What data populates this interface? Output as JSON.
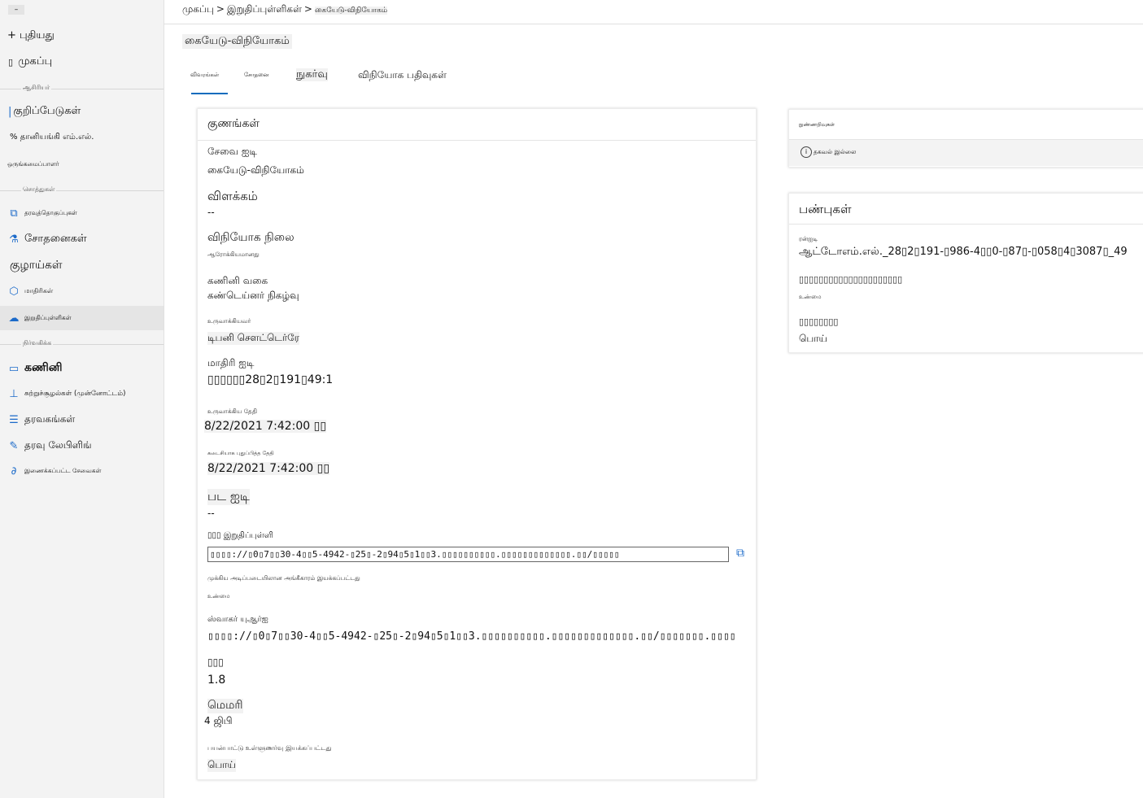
{
  "sidebar": {
    "collapse_label": "–",
    "new_label": "+ புதியது",
    "home_label": "முகப்பு",
    "sections": {
      "author": "ஆசிரியர்",
      "assets": "சொத்துகள்",
      "manage": "நிர்வகிக்க"
    },
    "items": [
      {
        "label": "குறிப்பேடுகள்",
        "icon": "notebook-icon"
      },
      {
        "label": "% தானியங்கி எம்.எல்.",
        "icon": "automl-icon"
      },
      {
        "label": "ஒருங்கமைப்பாளர்",
        "icon": "designer-icon"
      },
      {
        "label": "தரவுத்தொகுப்புகள்",
        "icon": "datasets-icon"
      },
      {
        "label": "சோதனைகள்",
        "icon": "flask-icon"
      },
      {
        "label": "குழாய்கள்",
        "icon": "pipeline-icon"
      },
      {
        "label": "மாதிரிகள்",
        "icon": "cube-icon"
      },
      {
        "label": "இறுதிப்புள்ளிகள்",
        "icon": "cloud-icon"
      },
      {
        "label": "கணினி",
        "icon": "monitor-icon"
      },
      {
        "label": "சுற்றுச்சூழல்கள் (முன்னோட்டம்)",
        "icon": "environment-icon"
      },
      {
        "label": "தரவகங்கள்",
        "icon": "database-icon"
      },
      {
        "label": "தரவு லேபிளிங்",
        "icon": "edit-icon"
      },
      {
        "label": "இணைக்கப்பட்ட சேவைகள்",
        "icon": "link-icon"
      }
    ]
  },
  "breadcrumb": {
    "home": "முகப்பு",
    "endpoints": "இறுதிப்புள்ளிகள்",
    "current": "கையேடு-விநியோகம்",
    "sep": ">"
  },
  "page_title": "கையேடு-விநியோகம்",
  "tabs": [
    {
      "label": "விவரங்கள்"
    },
    {
      "label": "சோதனை"
    },
    {
      "label": "நுகர்வு"
    },
    {
      "label": "விநியோக பதிவுகள்"
    }
  ],
  "attributes": {
    "title": "குணங்கள்",
    "service_id_label": "சேவை ஐடி",
    "service_id": "கையேடு-விநியோகம்",
    "description_label": "விளக்கம்",
    "description": "--",
    "deploy_state_label": "விநியோக நிலை",
    "deploy_state": "ஆரோக்கியமானது",
    "compute_type_label": "கணினி வகை",
    "compute_type": "கண்டெய்னர் நிகழ்வு",
    "created_by_label": "உருவாக்கியவர்",
    "created_by": "டிபனி சௌட்டெர்ரே",
    "model_id_label": "மாதிரி ஐடி",
    "model_id": "▯▯▯▯▯▯28▯2▯191▯49:1",
    "created_on_label": "உருவாக்கிய தேதி",
    "created_on": "8/22/2021 7:42:00 ▯▯",
    "updated_on_label": "கடைசியாக புதுப்பித்த தேதி",
    "updated_on": "8/22/2021 7:42:00 ▯▯",
    "image_id_label": "பட ஐடி",
    "image_id": "--",
    "rest_label": "▯▯▯ இறுதிப்புள்ளி",
    "rest_url": "▯▯▯▯://▯0▯7▯▯30-4▯▯5-4942-▯25▯-2▯94▯5▯1▯▯3.▯▯▯▯▯▯▯▯▯▯.▯▯▯▯▯▯▯▯▯▯▯▯▯.▯▯/▯▯▯▯▯",
    "key_auth_label": "முக்கிய அடிப்படையிலான அங்கீகாரம் இயக்கப்பட்டது",
    "key_auth": "உண்மை",
    "swagger_label": "ஸ்வாகர் யுஆர்ஐ",
    "swagger_url": "▯▯▯▯://▯0▯7▯▯30-4▯▯5-4942-▯25▯-2▯94▯5▯1▯▯3.▯▯▯▯▯▯▯▯▯▯.▯▯▯▯▯▯▯▯▯▯▯▯▯.▯▯/▯▯▯▯▯▯▯.▯▯▯▯",
    "cpu_label": "▯▯▯",
    "cpu": "1.8",
    "memory_label": "மெமரி",
    "memory": "4 ஜிபி",
    "appinsights_label": "பயன்பாட்டு உள்ளுணர்வு இயக்கப்பட்டது",
    "appinsights": "பொய்"
  },
  "insights_card": {
    "title": "நுண்ணறிவுகள்",
    "info": "தகவல் இல்லை",
    "info_icon": "info-icon"
  },
  "properties": {
    "title": "பண்புகள்",
    "name_label": "ரன்ஐடி",
    "name_value": "ஆட்டோஎம்.எல்._28▯2▯191-▯986-4▯▯0-▯87▯-▯058▯4▯3087▯_49",
    "key2_label": "▯▯▯▯▯▯▯▯▯▯▯▯▯▯▯▯▯▯▯▯▯",
    "key2_value": "உண்மை",
    "key3_label": "▯▯▯▯▯▯▯▯",
    "key3_value": "பொய்"
  },
  "colors": {
    "accent": "#0f6cbd",
    "sidebar_bg": "#f3f3f3"
  }
}
